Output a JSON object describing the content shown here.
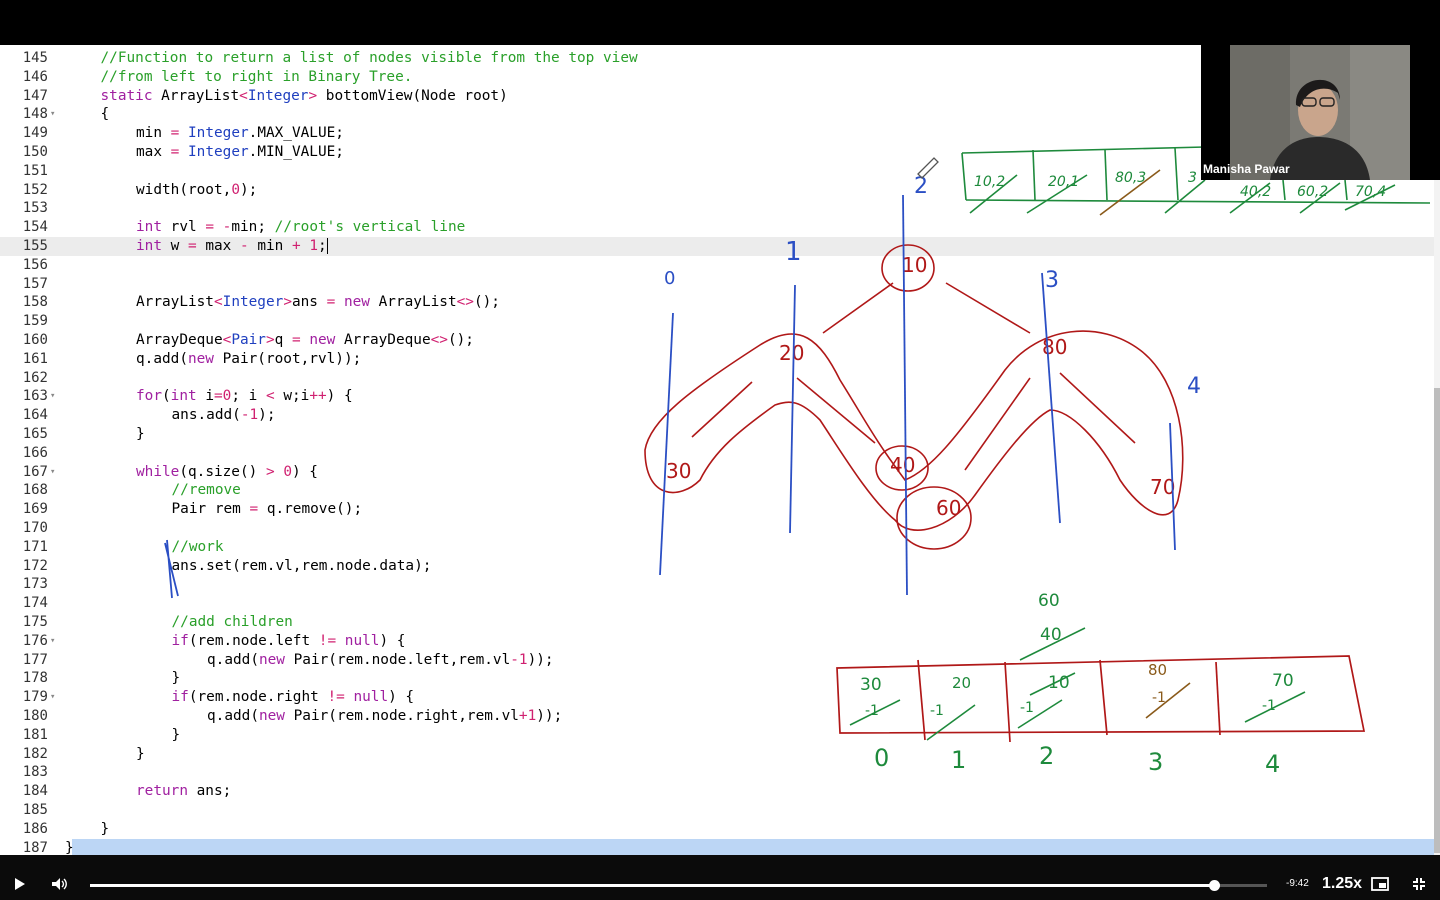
{
  "editor": {
    "lines": [
      {
        "n": "145",
        "indent": 1,
        "fold": false,
        "tokens": [
          [
            "c",
            "//Function to return a list of nodes visible from the top view"
          ]
        ]
      },
      {
        "n": "146",
        "indent": 1,
        "fold": false,
        "tokens": [
          [
            "c",
            "//from left to right in Binary Tree."
          ]
        ]
      },
      {
        "n": "147",
        "indent": 1,
        "fold": false,
        "tokens": [
          [
            "k",
            "static "
          ],
          [
            "p",
            "ArrayList"
          ],
          [
            "o",
            "<"
          ],
          [
            "t",
            "Integer"
          ],
          [
            "o",
            ">"
          ],
          [
            "p",
            " bottomView(Node root)"
          ]
        ]
      },
      {
        "n": "148",
        "indent": 1,
        "fold": true,
        "tokens": [
          [
            "p",
            "{"
          ]
        ]
      },
      {
        "n": "149",
        "indent": 2,
        "fold": false,
        "tokens": [
          [
            "p",
            "min "
          ],
          [
            "o",
            "="
          ],
          [
            "p",
            " "
          ],
          [
            "t",
            "Integer"
          ],
          [
            "p",
            ".MAX_VALUE;"
          ]
        ]
      },
      {
        "n": "150",
        "indent": 2,
        "fold": false,
        "tokens": [
          [
            "p",
            "max "
          ],
          [
            "o",
            "="
          ],
          [
            "p",
            " "
          ],
          [
            "t",
            "Integer"
          ],
          [
            "p",
            ".MIN_VALUE;"
          ]
        ]
      },
      {
        "n": "151",
        "indent": 0,
        "fold": false,
        "tokens": []
      },
      {
        "n": "152",
        "indent": 2,
        "fold": false,
        "tokens": [
          [
            "p",
            "width(root,"
          ],
          [
            "n",
            "0"
          ],
          [
            "p",
            ");"
          ]
        ]
      },
      {
        "n": "153",
        "indent": 0,
        "fold": false,
        "tokens": []
      },
      {
        "n": "154",
        "indent": 2,
        "fold": false,
        "tokens": [
          [
            "k",
            "int"
          ],
          [
            "p",
            " rvl "
          ],
          [
            "o",
            "="
          ],
          [
            "p",
            " "
          ],
          [
            "o",
            "-"
          ],
          [
            "p",
            "min; "
          ],
          [
            "c",
            "//root's vertical line"
          ]
        ]
      },
      {
        "n": "155",
        "indent": 2,
        "fold": false,
        "current": true,
        "tokens": [
          [
            "k",
            "int"
          ],
          [
            "p",
            " w "
          ],
          [
            "o",
            "="
          ],
          [
            "p",
            " max "
          ],
          [
            "o",
            "-"
          ],
          [
            "p",
            " min "
          ],
          [
            "o",
            "+"
          ],
          [
            "p",
            " "
          ],
          [
            "n",
            "1"
          ],
          [
            "p",
            ";"
          ]
        ]
      },
      {
        "n": "156",
        "indent": 0,
        "fold": false,
        "tokens": []
      },
      {
        "n": "157",
        "indent": 0,
        "fold": false,
        "tokens": []
      },
      {
        "n": "158",
        "indent": 2,
        "fold": false,
        "tokens": [
          [
            "p",
            "ArrayList"
          ],
          [
            "o",
            "<"
          ],
          [
            "t",
            "Integer"
          ],
          [
            "o",
            ">"
          ],
          [
            "p",
            "ans "
          ],
          [
            "o",
            "="
          ],
          [
            "p",
            " "
          ],
          [
            "k",
            "new"
          ],
          [
            "p",
            " ArrayList"
          ],
          [
            "o",
            "<>"
          ],
          [
            "p",
            "();"
          ]
        ]
      },
      {
        "n": "159",
        "indent": 0,
        "fold": false,
        "tokens": []
      },
      {
        "n": "160",
        "indent": 2,
        "fold": false,
        "tokens": [
          [
            "p",
            "ArrayDeque"
          ],
          [
            "o",
            "<"
          ],
          [
            "t",
            "Pair"
          ],
          [
            "o",
            ">"
          ],
          [
            "p",
            "q "
          ],
          [
            "o",
            "="
          ],
          [
            "p",
            " "
          ],
          [
            "k",
            "new"
          ],
          [
            "p",
            " ArrayDeque"
          ],
          [
            "o",
            "<>"
          ],
          [
            "p",
            "();"
          ]
        ]
      },
      {
        "n": "161",
        "indent": 2,
        "fold": false,
        "tokens": [
          [
            "p",
            "q.add("
          ],
          [
            "k",
            "new"
          ],
          [
            "p",
            " Pair(root,rvl));"
          ]
        ]
      },
      {
        "n": "162",
        "indent": 0,
        "fold": false,
        "tokens": []
      },
      {
        "n": "163",
        "indent": 2,
        "fold": true,
        "tokens": [
          [
            "k",
            "for"
          ],
          [
            "p",
            "("
          ],
          [
            "k",
            "int"
          ],
          [
            "p",
            " i"
          ],
          [
            "o",
            "="
          ],
          [
            "n",
            "0"
          ],
          [
            "p",
            "; i "
          ],
          [
            "o",
            "<"
          ],
          [
            "p",
            " w;i"
          ],
          [
            "o",
            "++"
          ],
          [
            "p",
            ") {"
          ]
        ]
      },
      {
        "n": "164",
        "indent": 3,
        "fold": false,
        "tokens": [
          [
            "p",
            "ans.add("
          ],
          [
            "o",
            "-"
          ],
          [
            "n",
            "1"
          ],
          [
            "p",
            ");"
          ]
        ]
      },
      {
        "n": "165",
        "indent": 2,
        "fold": false,
        "tokens": [
          [
            "p",
            "}"
          ]
        ]
      },
      {
        "n": "166",
        "indent": 0,
        "fold": false,
        "tokens": []
      },
      {
        "n": "167",
        "indent": 2,
        "fold": true,
        "tokens": [
          [
            "k",
            "while"
          ],
          [
            "p",
            "(q.size() "
          ],
          [
            "o",
            ">"
          ],
          [
            "p",
            " "
          ],
          [
            "n",
            "0"
          ],
          [
            "p",
            ") {"
          ]
        ]
      },
      {
        "n": "168",
        "indent": 3,
        "fold": false,
        "tokens": [
          [
            "c",
            "//remove"
          ]
        ]
      },
      {
        "n": "169",
        "indent": 3,
        "fold": false,
        "tokens": [
          [
            "p",
            "Pair rem "
          ],
          [
            "o",
            "="
          ],
          [
            "p",
            " q.remove();"
          ]
        ]
      },
      {
        "n": "170",
        "indent": 0,
        "fold": false,
        "tokens": []
      },
      {
        "n": "171",
        "indent": 3,
        "fold": false,
        "tokens": [
          [
            "c",
            "//work"
          ]
        ]
      },
      {
        "n": "172",
        "indent": 3,
        "fold": false,
        "tokens": [
          [
            "p",
            "ans.set(rem.vl,rem.node.data);"
          ]
        ]
      },
      {
        "n": "173",
        "indent": 0,
        "fold": false,
        "tokens": []
      },
      {
        "n": "174",
        "indent": 0,
        "fold": false,
        "tokens": []
      },
      {
        "n": "175",
        "indent": 3,
        "fold": false,
        "tokens": [
          [
            "c",
            "//add children"
          ]
        ]
      },
      {
        "n": "176",
        "indent": 3,
        "fold": true,
        "tokens": [
          [
            "k",
            "if"
          ],
          [
            "p",
            "(rem.node.left "
          ],
          [
            "o",
            "!="
          ],
          [
            "p",
            " "
          ],
          [
            "k",
            "null"
          ],
          [
            "p",
            ") {"
          ]
        ]
      },
      {
        "n": "177",
        "indent": 4,
        "fold": false,
        "tokens": [
          [
            "p",
            "q.add("
          ],
          [
            "k",
            "new"
          ],
          [
            "p",
            " Pair(rem.node.left,rem.vl"
          ],
          [
            "o",
            "-"
          ],
          [
            "n",
            "1"
          ],
          [
            "p",
            "));"
          ]
        ]
      },
      {
        "n": "178",
        "indent": 3,
        "fold": false,
        "tokens": [
          [
            "p",
            "}"
          ]
        ]
      },
      {
        "n": "179",
        "indent": 3,
        "fold": true,
        "tokens": [
          [
            "k",
            "if"
          ],
          [
            "p",
            "(rem.node.right "
          ],
          [
            "o",
            "!="
          ],
          [
            "p",
            " "
          ],
          [
            "k",
            "null"
          ],
          [
            "p",
            ") {"
          ]
        ]
      },
      {
        "n": "180",
        "indent": 4,
        "fold": false,
        "tokens": [
          [
            "p",
            "q.add("
          ],
          [
            "k",
            "new"
          ],
          [
            "p",
            " Pair(rem.node.right,rem.vl"
          ],
          [
            "o",
            "+"
          ],
          [
            "n",
            "1"
          ],
          [
            "p",
            "));"
          ]
        ]
      },
      {
        "n": "181",
        "indent": 3,
        "fold": false,
        "tokens": [
          [
            "p",
            "}"
          ]
        ]
      },
      {
        "n": "182",
        "indent": 2,
        "fold": false,
        "tokens": [
          [
            "p",
            "}"
          ]
        ]
      },
      {
        "n": "183",
        "indent": 0,
        "fold": false,
        "tokens": []
      },
      {
        "n": "184",
        "indent": 2,
        "fold": false,
        "tokens": [
          [
            "k",
            "return"
          ],
          [
            "p",
            " ans;"
          ]
        ]
      },
      {
        "n": "185",
        "indent": 0,
        "fold": false,
        "tokens": []
      },
      {
        "n": "186",
        "indent": 1,
        "fold": false,
        "tokens": [
          [
            "p",
            "}"
          ]
        ]
      },
      {
        "n": "187",
        "indent": 0,
        "fold": false,
        "selected": true,
        "tokens": [
          [
            "p",
            "}"
          ]
        ]
      }
    ]
  },
  "colors": {
    "comment": "#2aa02a",
    "keyword": "#a020a0",
    "type": "#1f3fbf",
    "operator": "#d02070",
    "ink_red": "#b01818",
    "ink_blue": "#2b4fc4",
    "ink_green": "#1e8a3c",
    "ink_brown": "#8a5a1a"
  },
  "webcam": {
    "name": "Manisha Pawar"
  },
  "annotations": {
    "column_labels": [
      "0",
      "1",
      "2",
      "3",
      "4"
    ],
    "tree_nodes": [
      "10",
      "20",
      "30",
      "40",
      "60",
      "80",
      "70"
    ],
    "queue_cells": [
      "10,2",
      "20,1",
      "80,3",
      "3",
      "40,2",
      "60,2",
      "70,4"
    ],
    "answer_cells": [
      {
        "values": [
          "30",
          "-1"
        ],
        "index": "0"
      },
      {
        "values": [
          "20",
          "-1"
        ],
        "index": "1"
      },
      {
        "values": [
          "10",
          "-1"
        ],
        "index": "2"
      },
      {
        "values": [
          "80",
          "-1"
        ],
        "index": "3"
      },
      {
        "values": [
          "70",
          "-1"
        ],
        "index": "4"
      }
    ],
    "above_answer": [
      "60",
      "40"
    ]
  },
  "player": {
    "time_remaining": "-9:42",
    "playback_rate": "1.25x",
    "progress": 0.955,
    "icons": [
      "play-icon",
      "volume-icon",
      "picture-in-picture-icon",
      "exit-fullscreen-icon"
    ]
  }
}
